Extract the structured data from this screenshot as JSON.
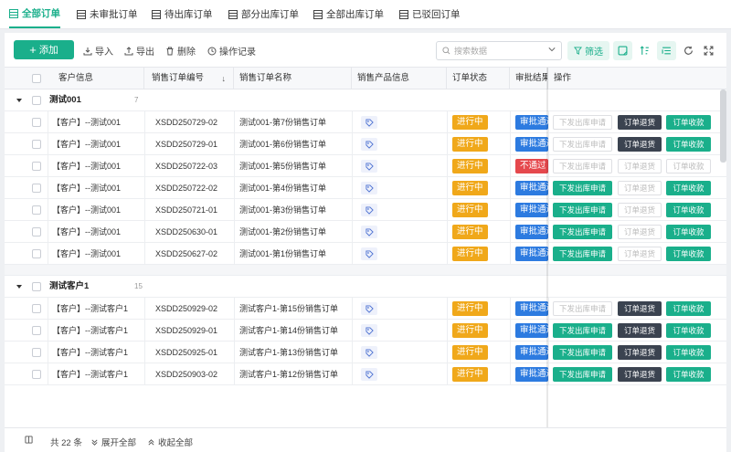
{
  "tabs": [
    {
      "label": "全部订单",
      "active": true
    },
    {
      "label": "未审批订单"
    },
    {
      "label": "待出库订单"
    },
    {
      "label": "部分出库订单"
    },
    {
      "label": "全部出库订单"
    },
    {
      "label": "已驳回订单"
    }
  ],
  "toolbar": {
    "add_label": "添加",
    "import_label": "导入",
    "export_label": "导出",
    "delete_label": "删除",
    "log_label": "操作记录",
    "search_placeholder": "搜索数据",
    "filter_label": "筛选"
  },
  "columns": [
    "客户信息",
    "销售订单编号",
    "销售订单名称",
    "销售产品信息",
    "订单状态",
    "审批结果",
    "操作"
  ],
  "groups": [
    {
      "name": "测试001",
      "count": "7",
      "rows": [
        {
          "customer": "【客户】--测试001",
          "code": "XSDD250729-02",
          "name": "测试001-第7份销售订单",
          "status": "进行中",
          "approval": "审批通过",
          "approval_color": "#2d7be0",
          "a1": "下发出库申请",
          "a1_style": "dis",
          "a2": "订单退货",
          "a2_style": "dark",
          "a3": "订单收款",
          "a3_style": "green"
        },
        {
          "customer": "【客户】--测试001",
          "code": "XSDD250729-01",
          "name": "测试001-第6份销售订单",
          "status": "进行中",
          "approval": "审批通过",
          "approval_color": "#2d7be0",
          "a1": "下发出库申请",
          "a1_style": "dis",
          "a2": "订单退货",
          "a2_style": "dark",
          "a3": "订单收款",
          "a3_style": "green"
        },
        {
          "customer": "【客户】--测试001",
          "code": "XSDD250722-03",
          "name": "测试001-第5份销售订单",
          "status": "进行中",
          "approval": "不通过",
          "approval_color": "#e5484d",
          "a1": "下发出库申请",
          "a1_style": "dis",
          "a2": "订单退货",
          "a2_style": "dis",
          "a3": "订单收款",
          "a3_style": "dis"
        },
        {
          "customer": "【客户】--测试001",
          "code": "XSDD250722-02",
          "name": "测试001-第4份销售订单",
          "status": "进行中",
          "approval": "审批通过",
          "approval_color": "#2d7be0",
          "a1": "下发出库申请",
          "a1_style": "green",
          "a2": "订单退货",
          "a2_style": "dis",
          "a3": "订单收款",
          "a3_style": "green"
        },
        {
          "customer": "【客户】--测试001",
          "code": "XSDD250721-01",
          "name": "测试001-第3份销售订单",
          "status": "进行中",
          "approval": "审批通过",
          "approval_color": "#2d7be0",
          "a1": "下发出库申请",
          "a1_style": "green",
          "a2": "订单退货",
          "a2_style": "dis",
          "a3": "订单收款",
          "a3_style": "green"
        },
        {
          "customer": "【客户】--测试001",
          "code": "XSDD250630-01",
          "name": "测试001-第2份销售订单",
          "status": "进行中",
          "approval": "审批通过",
          "approval_color": "#2d7be0",
          "a1": "下发出库申请",
          "a1_style": "green",
          "a2": "订单退货",
          "a2_style": "dis",
          "a3": "订单收款",
          "a3_style": "green"
        },
        {
          "customer": "【客户】--测试001",
          "code": "XSDD250627-02",
          "name": "测试001-第1份销售订单",
          "status": "进行中",
          "approval": "审批通过",
          "approval_color": "#2d7be0",
          "a1": "下发出库申请",
          "a1_style": "green",
          "a2": "订单退货",
          "a2_style": "dis",
          "a3": "订单收款",
          "a3_style": "green"
        }
      ]
    },
    {
      "name": "测试客户1",
      "count": "15",
      "rows": [
        {
          "customer": "【客户】--测试客户1",
          "code": "XSDD250929-02",
          "name": "测试客户1-第15份销售订单",
          "status": "进行中",
          "approval": "审批通过",
          "approval_color": "#2d7be0",
          "a1": "下发出库申请",
          "a1_style": "dis",
          "a2": "订单退货",
          "a2_style": "dark",
          "a3": "订单收款",
          "a3_style": "green"
        },
        {
          "customer": "【客户】--测试客户1",
          "code": "XSDD250929-01",
          "name": "测试客户1-第14份销售订单",
          "status": "进行中",
          "approval": "审批通过",
          "approval_color": "#2d7be0",
          "a1": "下发出库申请",
          "a1_style": "green",
          "a2": "订单退货",
          "a2_style": "dark",
          "a3": "订单收款",
          "a3_style": "green"
        },
        {
          "customer": "【客户】--测试客户1",
          "code": "XSDD250925-01",
          "name": "测试客户1-第13份销售订单",
          "status": "进行中",
          "approval": "审批通过",
          "approval_color": "#2d7be0",
          "a1": "下发出库申请",
          "a1_style": "green",
          "a2": "订单退货",
          "a2_style": "dark",
          "a3": "订单收款",
          "a3_style": "green"
        },
        {
          "customer": "【客户】--测试客户1",
          "code": "XSDD250903-02",
          "name": "测试客户1-第12份销售订单",
          "status": "进行中",
          "approval": "审批通过",
          "approval_color": "#2d7be0",
          "a1": "下发出库申请",
          "a1_style": "green",
          "a2": "订单退货",
          "a2_style": "dark",
          "a3": "订单收款",
          "a3_style": "green"
        }
      ]
    }
  ],
  "footer": {
    "total_label": "共 22 条",
    "expand_label": "展开全部",
    "collapse_label": "收起全部"
  },
  "colors": {
    "accent": "#1aaf8b",
    "running": "#f0a81a",
    "approved": "#2d7be0",
    "rejected": "#e5484d",
    "dark_button": "#3b4350"
  }
}
